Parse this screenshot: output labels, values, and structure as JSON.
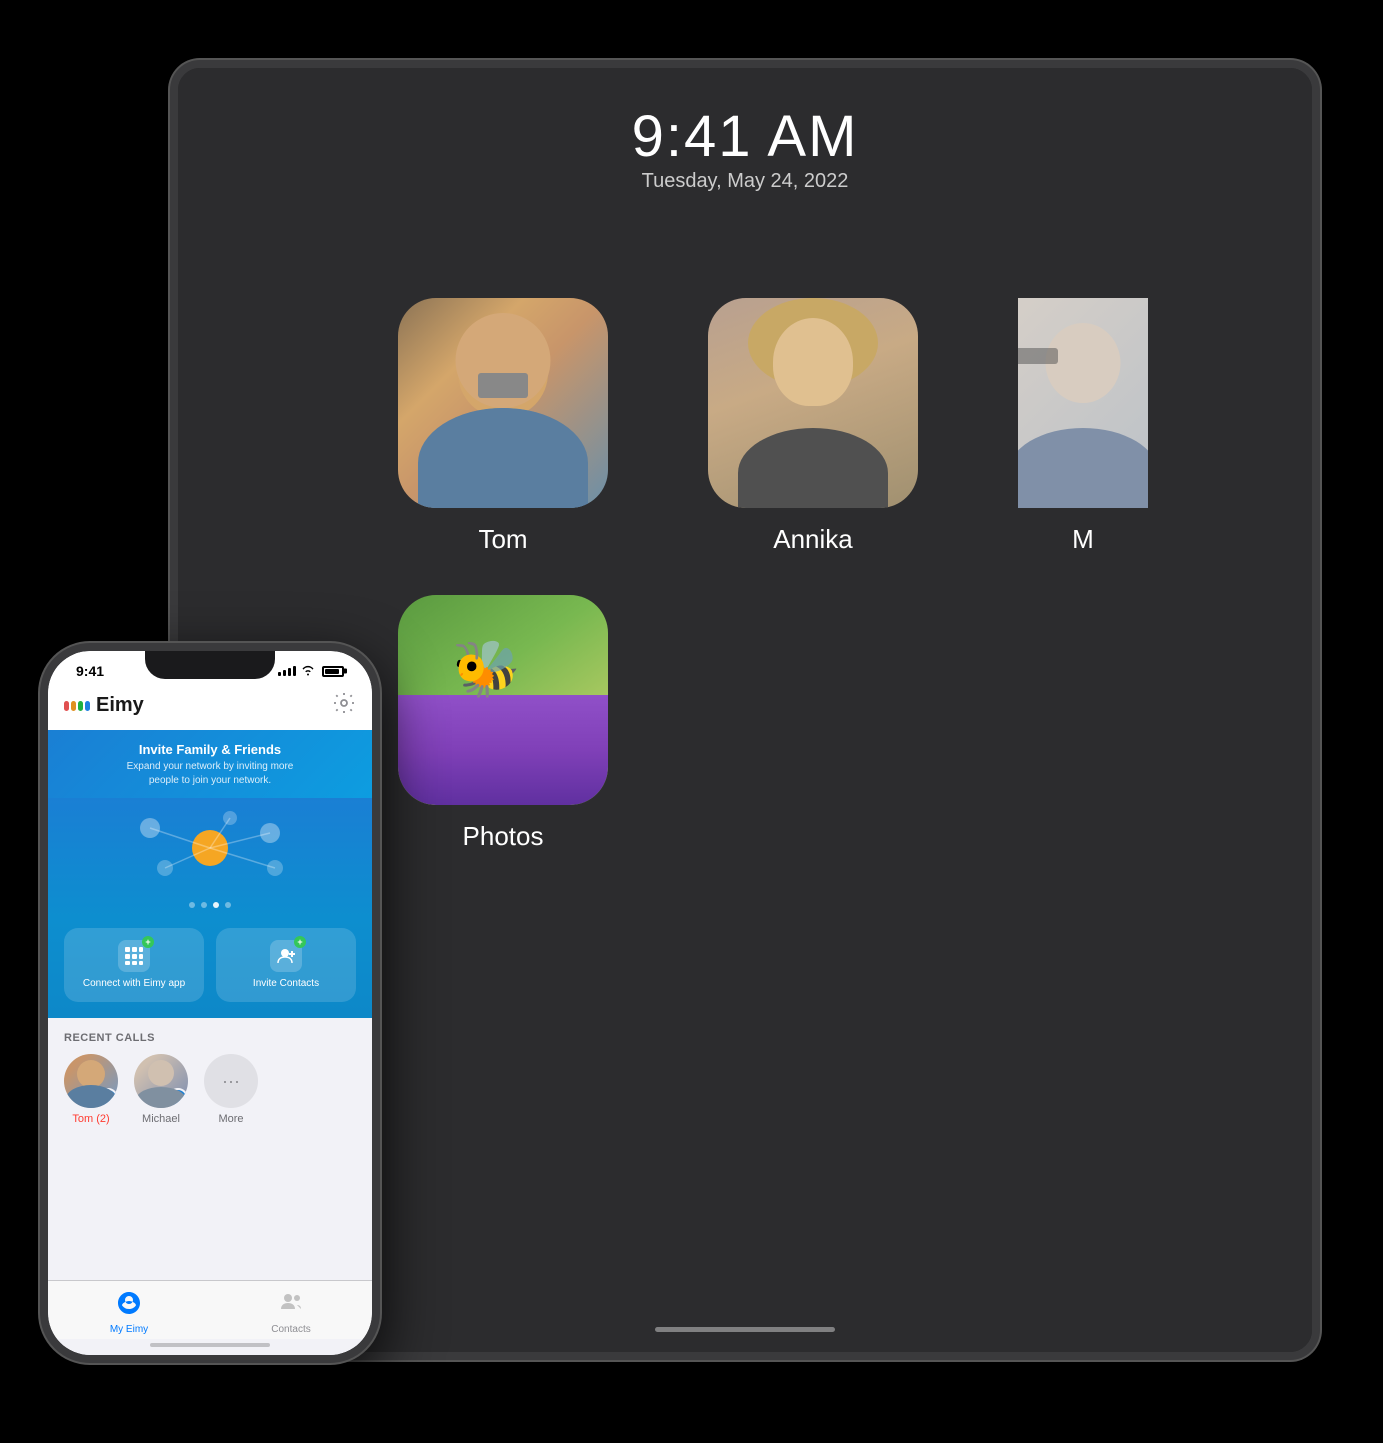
{
  "background_color": "#000000",
  "tablet": {
    "time": "9:41 AM",
    "date": "Tuesday, May 24, 2022",
    "contacts": [
      {
        "name": "Tom",
        "avatar_type": "tom"
      },
      {
        "name": "Annika",
        "avatar_type": "annika"
      },
      {
        "name": "M",
        "avatar_type": "third",
        "partial": true
      },
      {
        "name": "Photos",
        "avatar_type": "photos"
      }
    ]
  },
  "phone": {
    "status_bar": {
      "time": "9:41",
      "signal": true,
      "wifi": true,
      "battery": true
    },
    "header": {
      "app_name": "Eimy",
      "settings_label": "Settings"
    },
    "banner": {
      "title": "Invite Family & Friends",
      "subtitle": "Expand your network by inviting more\npeople to join your network."
    },
    "action_buttons": [
      {
        "label": "Connect with\nEimy app",
        "icon": "grid"
      },
      {
        "label": "Invite\nContacts",
        "icon": "person-plus"
      }
    ],
    "recent_calls_section": {
      "title": "RECENT CALLS",
      "calls": [
        {
          "name": "Tom (2)",
          "missed": true,
          "has_video_badge": true
        },
        {
          "name": "Michael",
          "missed": false,
          "has_video_badge": true
        },
        {
          "name": "More",
          "missed": false,
          "is_more": true
        }
      ]
    },
    "tabs": [
      {
        "label": "My Eimy",
        "active": true
      },
      {
        "label": "Contacts",
        "active": false
      }
    ]
  }
}
